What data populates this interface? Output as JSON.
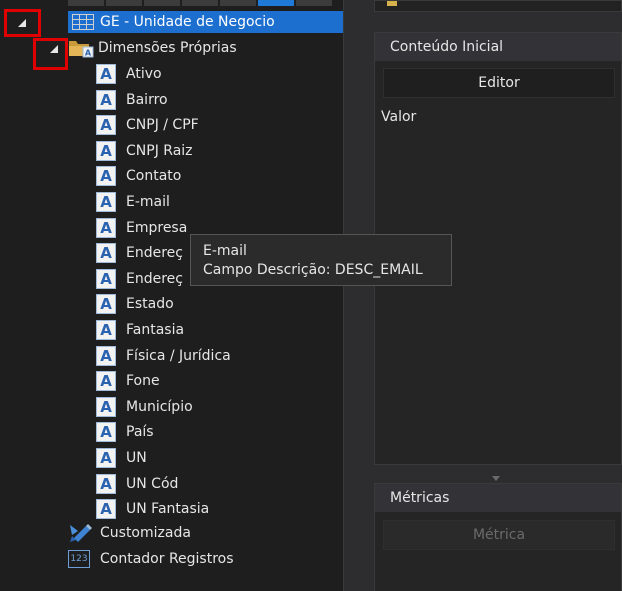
{
  "tree": {
    "root_label": "GE - Unidade de Negocio",
    "group_label": "Dimensões Próprias",
    "attribute_icon_letter": "A",
    "items": [
      {
        "label": "Ativo"
      },
      {
        "label": "Bairro"
      },
      {
        "label": "CNPJ / CPF"
      },
      {
        "label": "CNPJ Raiz"
      },
      {
        "label": "Contato"
      },
      {
        "label": "E-mail"
      },
      {
        "label": "Empresa"
      },
      {
        "label": "Endereç"
      },
      {
        "label": "Endereç"
      },
      {
        "label": "Estado"
      },
      {
        "label": "Fantasia"
      },
      {
        "label": "Física / Jurídica"
      },
      {
        "label": "Fone"
      },
      {
        "label": "Município"
      },
      {
        "label": "País"
      },
      {
        "label": "UN"
      },
      {
        "label": "UN Cód"
      },
      {
        "label": "UN Fantasia"
      }
    ],
    "custom_label": "Customizada",
    "counter_label": "Contador Registros",
    "counter_icon_text": "123"
  },
  "tooltip": {
    "line1": "E-mail",
    "line2": "Campo Descrição: DESC_EMAIL"
  },
  "right": {
    "initial_content": {
      "header": "Conteúdo Inicial",
      "editor_button": "Editor",
      "value_label": "Valor"
    },
    "metrics": {
      "header": "Métricas",
      "metric_button": "Métrica"
    }
  },
  "colors": {
    "selection": "#1c6fce",
    "highlight_box": "#e00000",
    "attribute_icon": "#2a62b0"
  }
}
